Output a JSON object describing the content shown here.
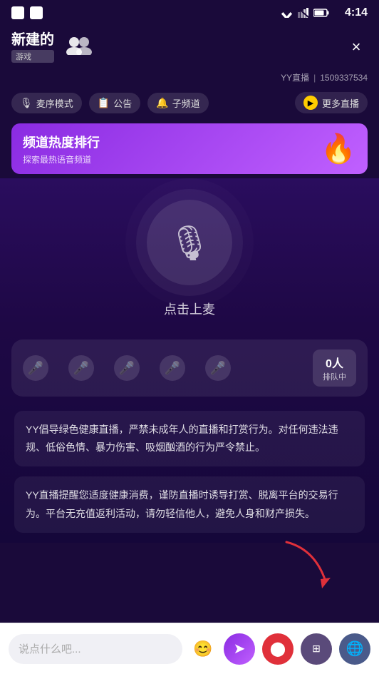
{
  "statusBar": {
    "time": "4:14"
  },
  "header": {
    "channelName": "新建的",
    "channelTag": "游戏",
    "closeLabel": "×",
    "yyLive": "YY直播",
    "phone": "1509337534"
  },
  "toolbar": {
    "micMode": "麦序模式",
    "notice": "公告",
    "subchannel": "子频道",
    "moreLive": "更多直播"
  },
  "banner": {
    "title": "频道热度排行",
    "subtitle": "探索最热语音频道"
  },
  "main": {
    "tapToMic": "点击上麦",
    "queueCount": "0人",
    "queueLabel": "排队中"
  },
  "notices": [
    "YY倡导绿色健康直播，严禁未成年人的直播和打赏行为。对任何违法违规、低俗色情、暴力伤害、吸烟酗酒的行为严令禁止。",
    "YY直播提醒您适度健康消费，谨防直播时诱导打赏、脱离平台的交易行为。平台无充值返利活动，请勿轻信他人，避免人身和财产损失。"
  ],
  "bottomBar": {
    "placeholder": "说点什么吧..."
  }
}
